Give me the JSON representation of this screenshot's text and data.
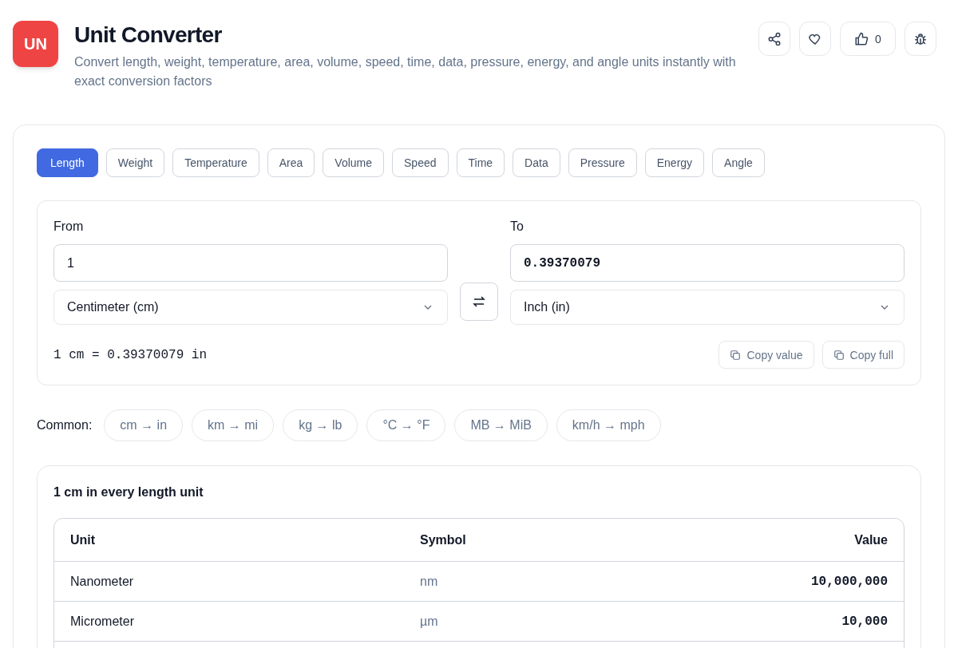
{
  "header": {
    "logo": "UN",
    "title": "Unit Converter",
    "description": "Convert length, weight, temperature, area, volume, speed, time, data, pressure, energy, and angle units instantly with exact conversion factors",
    "like_count": "0"
  },
  "tabs": [
    {
      "label": "Length",
      "selected": true
    },
    {
      "label": "Weight",
      "selected": false
    },
    {
      "label": "Temperature",
      "selected": false
    },
    {
      "label": "Area",
      "selected": false
    },
    {
      "label": "Volume",
      "selected": false
    },
    {
      "label": "Speed",
      "selected": false
    },
    {
      "label": "Time",
      "selected": false
    },
    {
      "label": "Data",
      "selected": false
    },
    {
      "label": "Pressure",
      "selected": false
    },
    {
      "label": "Energy",
      "selected": false
    },
    {
      "label": "Angle",
      "selected": false
    }
  ],
  "converter": {
    "from": {
      "label": "From",
      "value": "1",
      "unit": "Centimeter (cm)"
    },
    "to": {
      "label": "To",
      "value": "0.39370079",
      "unit": "Inch (in)"
    },
    "formula": "1 cm = 0.39370079 in",
    "buttons": [
      "Copy value",
      "Copy full"
    ]
  },
  "common": {
    "label": "Common:",
    "items": [
      "cm → in",
      "km → mi",
      "kg → lb",
      "°C → °F",
      "MB → MiB",
      "km/h → mph"
    ]
  },
  "table": {
    "title": "1 cm in every length unit",
    "columns": [
      "Unit",
      "Symbol",
      "Value"
    ],
    "rows": [
      {
        "unit": "Nanometer",
        "symbol": "nm",
        "value": "10,000,000"
      },
      {
        "unit": "Micrometer",
        "symbol": "µm",
        "value": "10,000"
      }
    ]
  }
}
